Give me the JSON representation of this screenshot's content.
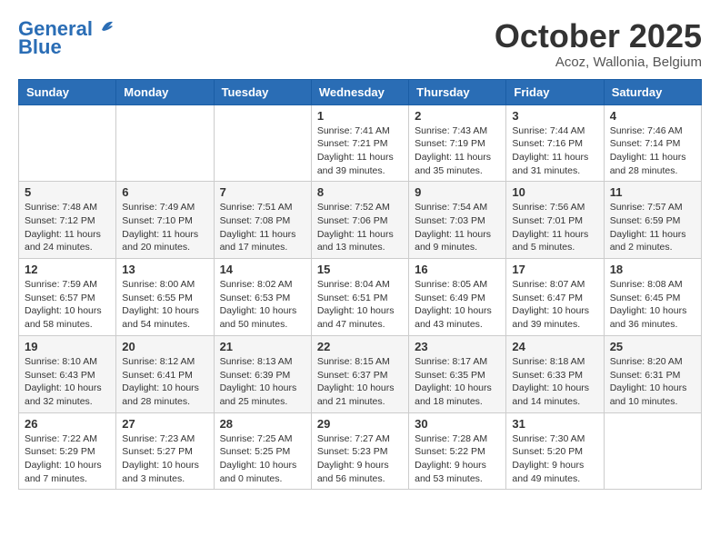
{
  "logo": {
    "part1": "General",
    "part2": "Blue"
  },
  "header": {
    "month": "October 2025",
    "location": "Acoz, Wallonia, Belgium"
  },
  "weekdays": [
    "Sunday",
    "Monday",
    "Tuesday",
    "Wednesday",
    "Thursday",
    "Friday",
    "Saturday"
  ],
  "weeks": [
    [
      {
        "day": "",
        "info": ""
      },
      {
        "day": "",
        "info": ""
      },
      {
        "day": "",
        "info": ""
      },
      {
        "day": "1",
        "info": "Sunrise: 7:41 AM\nSunset: 7:21 PM\nDaylight: 11 hours\nand 39 minutes."
      },
      {
        "day": "2",
        "info": "Sunrise: 7:43 AM\nSunset: 7:19 PM\nDaylight: 11 hours\nand 35 minutes."
      },
      {
        "day": "3",
        "info": "Sunrise: 7:44 AM\nSunset: 7:16 PM\nDaylight: 11 hours\nand 31 minutes."
      },
      {
        "day": "4",
        "info": "Sunrise: 7:46 AM\nSunset: 7:14 PM\nDaylight: 11 hours\nand 28 minutes."
      }
    ],
    [
      {
        "day": "5",
        "info": "Sunrise: 7:48 AM\nSunset: 7:12 PM\nDaylight: 11 hours\nand 24 minutes."
      },
      {
        "day": "6",
        "info": "Sunrise: 7:49 AM\nSunset: 7:10 PM\nDaylight: 11 hours\nand 20 minutes."
      },
      {
        "day": "7",
        "info": "Sunrise: 7:51 AM\nSunset: 7:08 PM\nDaylight: 11 hours\nand 17 minutes."
      },
      {
        "day": "8",
        "info": "Sunrise: 7:52 AM\nSunset: 7:06 PM\nDaylight: 11 hours\nand 13 minutes."
      },
      {
        "day": "9",
        "info": "Sunrise: 7:54 AM\nSunset: 7:03 PM\nDaylight: 11 hours\nand 9 minutes."
      },
      {
        "day": "10",
        "info": "Sunrise: 7:56 AM\nSunset: 7:01 PM\nDaylight: 11 hours\nand 5 minutes."
      },
      {
        "day": "11",
        "info": "Sunrise: 7:57 AM\nSunset: 6:59 PM\nDaylight: 11 hours\nand 2 minutes."
      }
    ],
    [
      {
        "day": "12",
        "info": "Sunrise: 7:59 AM\nSunset: 6:57 PM\nDaylight: 10 hours\nand 58 minutes."
      },
      {
        "day": "13",
        "info": "Sunrise: 8:00 AM\nSunset: 6:55 PM\nDaylight: 10 hours\nand 54 minutes."
      },
      {
        "day": "14",
        "info": "Sunrise: 8:02 AM\nSunset: 6:53 PM\nDaylight: 10 hours\nand 50 minutes."
      },
      {
        "day": "15",
        "info": "Sunrise: 8:04 AM\nSunset: 6:51 PM\nDaylight: 10 hours\nand 47 minutes."
      },
      {
        "day": "16",
        "info": "Sunrise: 8:05 AM\nSunset: 6:49 PM\nDaylight: 10 hours\nand 43 minutes."
      },
      {
        "day": "17",
        "info": "Sunrise: 8:07 AM\nSunset: 6:47 PM\nDaylight: 10 hours\nand 39 minutes."
      },
      {
        "day": "18",
        "info": "Sunrise: 8:08 AM\nSunset: 6:45 PM\nDaylight: 10 hours\nand 36 minutes."
      }
    ],
    [
      {
        "day": "19",
        "info": "Sunrise: 8:10 AM\nSunset: 6:43 PM\nDaylight: 10 hours\nand 32 minutes."
      },
      {
        "day": "20",
        "info": "Sunrise: 8:12 AM\nSunset: 6:41 PM\nDaylight: 10 hours\nand 28 minutes."
      },
      {
        "day": "21",
        "info": "Sunrise: 8:13 AM\nSunset: 6:39 PM\nDaylight: 10 hours\nand 25 minutes."
      },
      {
        "day": "22",
        "info": "Sunrise: 8:15 AM\nSunset: 6:37 PM\nDaylight: 10 hours\nand 21 minutes."
      },
      {
        "day": "23",
        "info": "Sunrise: 8:17 AM\nSunset: 6:35 PM\nDaylight: 10 hours\nand 18 minutes."
      },
      {
        "day": "24",
        "info": "Sunrise: 8:18 AM\nSunset: 6:33 PM\nDaylight: 10 hours\nand 14 minutes."
      },
      {
        "day": "25",
        "info": "Sunrise: 8:20 AM\nSunset: 6:31 PM\nDaylight: 10 hours\nand 10 minutes."
      }
    ],
    [
      {
        "day": "26",
        "info": "Sunrise: 7:22 AM\nSunset: 5:29 PM\nDaylight: 10 hours\nand 7 minutes."
      },
      {
        "day": "27",
        "info": "Sunrise: 7:23 AM\nSunset: 5:27 PM\nDaylight: 10 hours\nand 3 minutes."
      },
      {
        "day": "28",
        "info": "Sunrise: 7:25 AM\nSunset: 5:25 PM\nDaylight: 10 hours\nand 0 minutes."
      },
      {
        "day": "29",
        "info": "Sunrise: 7:27 AM\nSunset: 5:23 PM\nDaylight: 9 hours\nand 56 minutes."
      },
      {
        "day": "30",
        "info": "Sunrise: 7:28 AM\nSunset: 5:22 PM\nDaylight: 9 hours\nand 53 minutes."
      },
      {
        "day": "31",
        "info": "Sunrise: 7:30 AM\nSunset: 5:20 PM\nDaylight: 9 hours\nand 49 minutes."
      },
      {
        "day": "",
        "info": ""
      }
    ]
  ]
}
